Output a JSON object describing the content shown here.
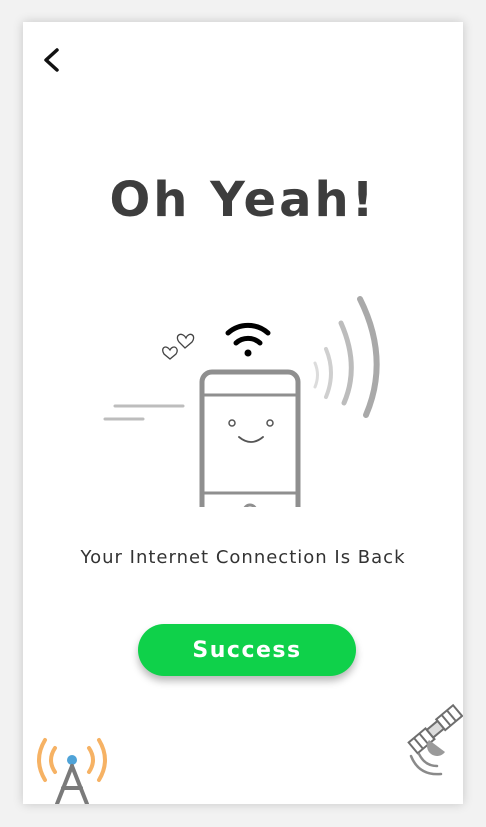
{
  "nav": {
    "back_icon": "chevron-left-icon"
  },
  "header": {
    "title": "Oh Yeah!"
  },
  "illustration": {
    "icons": [
      "wifi-icon",
      "smartphone-icon",
      "hearts-icon",
      "signal-waves-icon",
      "speed-lines-icon"
    ]
  },
  "message": {
    "text": "Your Internet Connection Is Back"
  },
  "actions": {
    "success_label": "Success"
  },
  "decorations": {
    "left": "radio-tower-icon",
    "right": "satellite-icon"
  },
  "colors": {
    "accent": "#0fd14a",
    "title": "#3d3d3d",
    "text": "#333333"
  }
}
